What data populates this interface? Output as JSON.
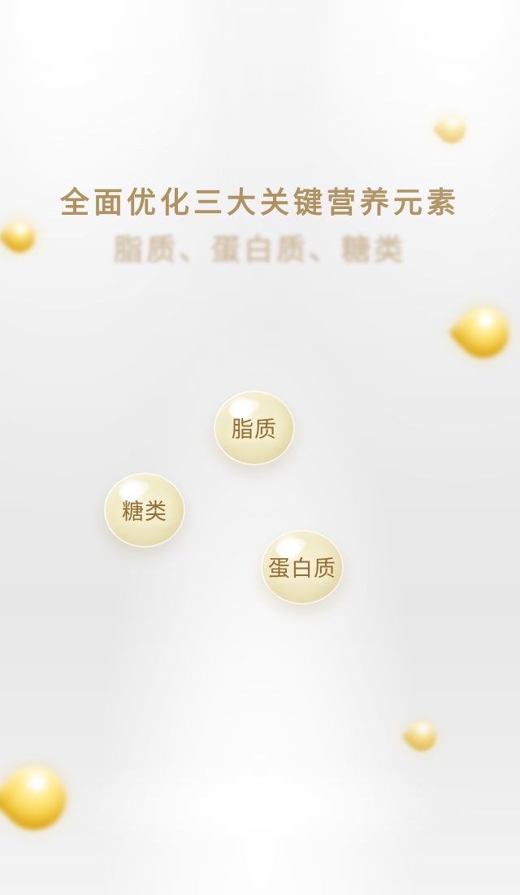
{
  "header": {
    "title": "全面优化三大关键营养元素",
    "subtitle": "脂质、蛋白质、糖类"
  },
  "nutrients": [
    {
      "label": "脂质"
    },
    {
      "label": "糖类"
    },
    {
      "label": "蛋白质"
    }
  ],
  "decorations": {
    "drops": [
      {
        "icon": "oil-drop-icon"
      },
      {
        "icon": "oil-drop-icon"
      },
      {
        "icon": "oil-drop-icon"
      },
      {
        "icon": "oil-drop-icon"
      },
      {
        "icon": "oil-drop-icon"
      }
    ]
  },
  "colors": {
    "title": "#b09261",
    "subtitle": "#c7b090",
    "bubble_text": "#946d33",
    "drop_gold": "#f7d24a"
  }
}
